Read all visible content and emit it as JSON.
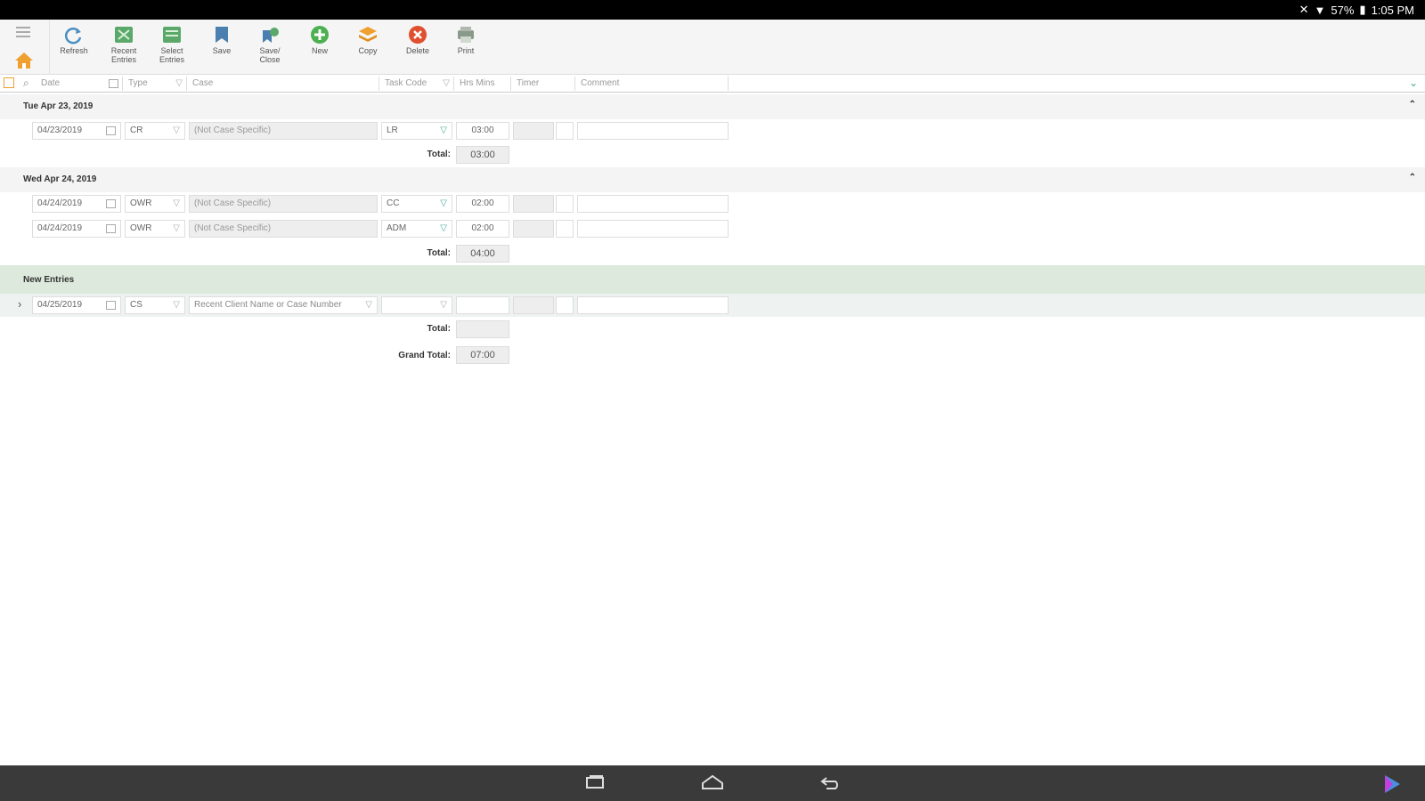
{
  "status_bar": {
    "battery": "57%",
    "time": "1:05 PM"
  },
  "toolbar": {
    "buttons": [
      {
        "label": "Refresh"
      },
      {
        "label": "Recent\nEntries"
      },
      {
        "label": "Select\nEntries"
      },
      {
        "label": "Save"
      },
      {
        "label": "Save/\nClose"
      },
      {
        "label": "New"
      },
      {
        "label": "Copy"
      },
      {
        "label": "Delete"
      },
      {
        "label": "Print"
      }
    ]
  },
  "filters": {
    "date": "Date",
    "type": "Type",
    "case": "Case",
    "task_code": "Task Code",
    "hrs_mins": "Hrs Mins",
    "timer": "Timer",
    "comment": "Comment"
  },
  "days": [
    {
      "title": "Tue  Apr 23, 2019",
      "entries": [
        {
          "date": "04/23/2019",
          "type": "CR",
          "case": "(Not Case Specific)",
          "task_code": "LR",
          "hrs": "03:00"
        }
      ],
      "total_label": "Total:",
      "total": "03:00"
    },
    {
      "title": "Wed  Apr 24, 2019",
      "entries": [
        {
          "date": "04/24/2019",
          "type": "OWR",
          "case": "(Not Case Specific)",
          "task_code": "CC",
          "hrs": "02:00"
        },
        {
          "date": "04/24/2019",
          "type": "OWR",
          "case": "(Not Case Specific)",
          "task_code": "ADM",
          "hrs": "02:00"
        }
      ],
      "total_label": "Total:",
      "total": "04:00"
    }
  ],
  "new_entries": {
    "title": "New Entries",
    "row": {
      "date": "04/25/2019",
      "type": "CS",
      "case_placeholder": "Recent Client Name or Case Number"
    },
    "total_label": "Total:",
    "total": ""
  },
  "grand_total": {
    "label": "Grand Total:",
    "value": "07:00"
  },
  "colors": {
    "home_icon": "#f0a030",
    "add_icon": "#4caf50",
    "delete_icon": "#e05030",
    "new_header_bg": "#dde9dc"
  }
}
